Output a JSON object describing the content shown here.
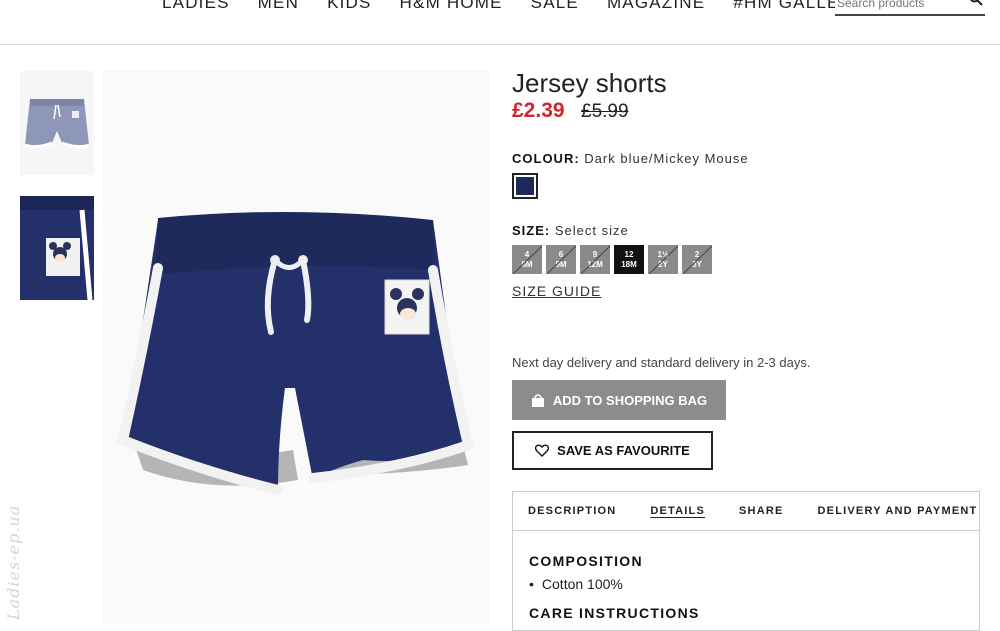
{
  "nav": {
    "items": [
      "LADIES",
      "MEN",
      "KIDS",
      "H&M HOME",
      "SALE",
      "MAGAZINE",
      "#HM GALLERY"
    ],
    "search_placeholder": "Search products"
  },
  "product": {
    "title": "Jersey shorts",
    "price": "£2.39",
    "old_price": "£5.99",
    "colour_label": "COLOUR:",
    "colour_value": "Dark blue/Mickey Mouse",
    "size_label": "SIZE:",
    "size_value": "Select size",
    "sizes": [
      {
        "top": "4",
        "bottom": "6M",
        "status": "unavailable"
      },
      {
        "top": "6",
        "bottom": "9M",
        "status": "unavailable"
      },
      {
        "top": "9",
        "bottom": "12M",
        "status": "unavailable"
      },
      {
        "top": "12",
        "bottom": "18M",
        "status": "selected"
      },
      {
        "top": "1½",
        "bottom": "2Y",
        "status": "unavailable"
      },
      {
        "top": "2",
        "bottom": "3Y",
        "status": "unavailable"
      }
    ],
    "size_guide": "SIZE GUIDE",
    "delivery": "Next day delivery and standard delivery in 2-3 days.",
    "add_to_bag": "ADD TO SHOPPING BAG",
    "save_favourite": "SAVE AS FAVOURITE"
  },
  "tabs": [
    "DESCRIPTION",
    "DETAILS",
    "SHARE",
    "DELIVERY AND PAYMENT"
  ],
  "active_tab": "DETAILS",
  "details": {
    "composition_title": "COMPOSITION",
    "composition_item": "Cotton 100%",
    "care_title": "CARE INSTRUCTIONS"
  },
  "watermark": "Ladies-ep.ua",
  "colors": {
    "sale_red": "#d2232a",
    "shorts_navy": "#23306a",
    "button_grey": "#8c8c8c"
  },
  "icons": [
    "search-icon",
    "shopping-bag-icon",
    "heart-icon"
  ]
}
